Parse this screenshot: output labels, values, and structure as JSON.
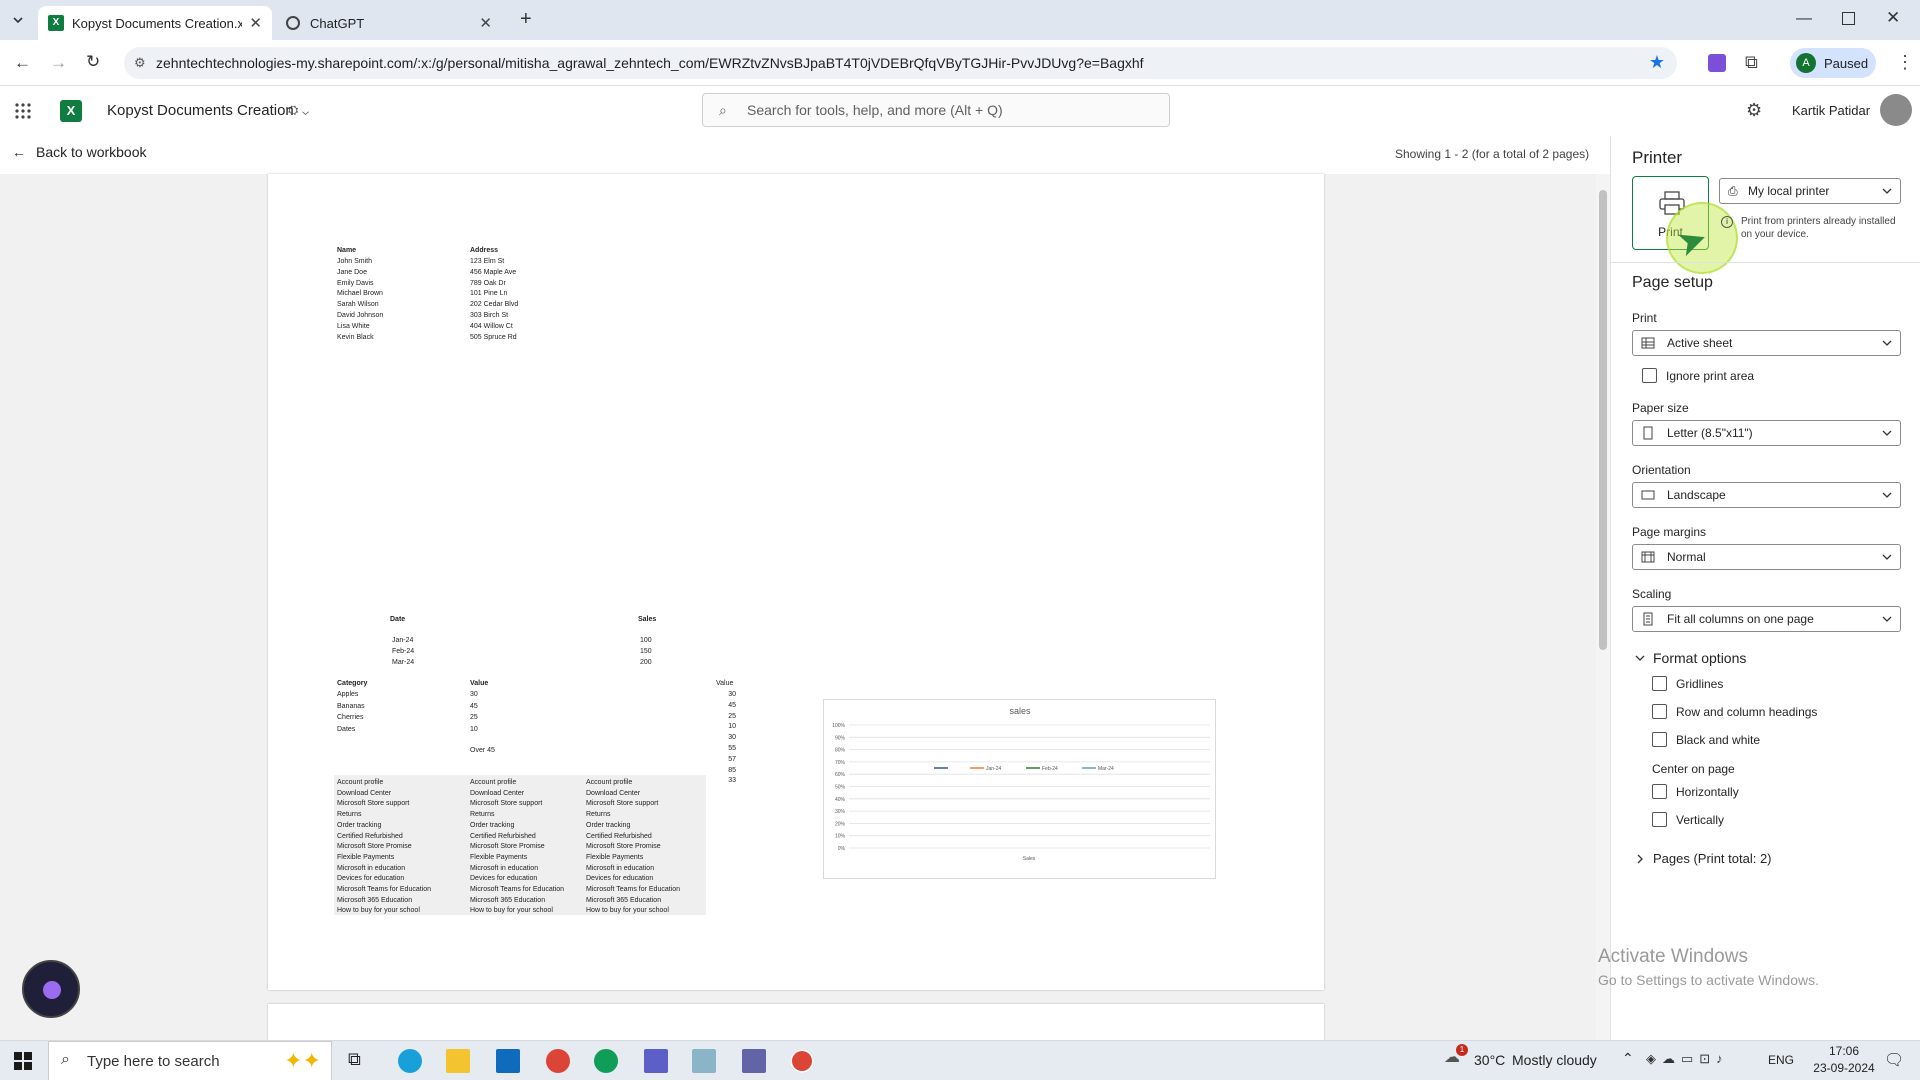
{
  "browser": {
    "tabs": [
      {
        "title": "Kopyst Documents Creation.xls",
        "active": true
      },
      {
        "title": "ChatGPT",
        "active": false
      }
    ],
    "url": "zehntechtechnologies-my.sharepoint.com/:x:/g/personal/mitisha_agrawal_zehntech_com/EWRZtvZNvsBJpaBT4T0jVDEBrQfqVByTGJHir-PvvJDUvg?e=Bagxhf",
    "profile_label": "A",
    "profile_status": "Paused"
  },
  "excel": {
    "app_icon": "X",
    "doc_title": "Kopyst Documents Creation",
    "search_placeholder": "Search for tools, help, and more (Alt + Q)",
    "user_name": "Kartik Patidar"
  },
  "preview": {
    "back_label": "Back to workbook",
    "showing": "Showing 1 - 2 (for a total of 2 pages)",
    "table1": {
      "headers": [
        "Name",
        "Address"
      ],
      "rows": [
        [
          "John Smith",
          "123 Elm St"
        ],
        [
          "Jane Doe",
          "456 Maple Ave"
        ],
        [
          "Emily Davis",
          "789 Oak Dr"
        ],
        [
          "Michael Brown",
          "101 Pine Ln"
        ],
        [
          "Sarah Wilson",
          "202 Cedar Blvd"
        ],
        [
          "David Johnson",
          "303 Birch St"
        ],
        [
          "Lisa White",
          "404 Willow Ct"
        ],
        [
          "Kevin Black",
          "505 Spruce Rd"
        ]
      ]
    },
    "table2": {
      "headers": [
        "Date",
        "Sales"
      ],
      "rows": [
        [
          "Jan-24",
          "100"
        ],
        [
          "Feb-24",
          "150"
        ],
        [
          "Mar-24",
          "200"
        ]
      ]
    },
    "table3": {
      "headers": [
        "Category",
        "Value"
      ],
      "rows": [
        [
          "Apples",
          "30"
        ],
        [
          "Bananas",
          "45"
        ],
        [
          "Cherries",
          "25"
        ],
        [
          "Dates",
          "10"
        ]
      ],
      "note": "Over 45"
    },
    "value_col": {
      "header": "Value",
      "values": [
        "30",
        "45",
        "25",
        "10",
        "30",
        "55",
        "57",
        "85",
        "33"
      ]
    },
    "links_table": {
      "items": [
        "Account profile",
        "Download Center",
        "Microsoft Store support",
        "Returns",
        "Order tracking",
        "Certified Refurbished",
        "Microsoft Store Promise",
        "Flexible Payments",
        "Microsoft in education",
        "Devices for education",
        "Microsoft Teams for Education",
        "Microsoft 365 Education",
        "How to buy for your school"
      ]
    }
  },
  "chart_data": {
    "type": "line",
    "title": "sales",
    "xlabel": "Sales",
    "ylabel": "",
    "y_ticks": [
      "0%",
      "10%",
      "20%",
      "30%",
      "40%",
      "50%",
      "60%",
      "70%",
      "80%",
      "90%",
      "100%"
    ],
    "ylim": [
      0,
      100
    ],
    "legend_position": "center",
    "series": [
      {
        "name": "",
        "color": "#2f5597"
      },
      {
        "name": "Jan-24",
        "color": "#ed7d31"
      },
      {
        "name": "Feb-24",
        "color": "#2e7d32"
      },
      {
        "name": "Mar-24",
        "color": "#5b9bd5"
      }
    ]
  },
  "panel": {
    "printer_title": "Printer",
    "print_button": "Print",
    "printer_select": "My local printer",
    "printer_info": "Print from printers already installed on your device.",
    "page_setup_title": "Page setup",
    "print_label": "Print",
    "print_value": "Active sheet",
    "ignore_print_area": "Ignore print area",
    "paper_size_label": "Paper size",
    "paper_size_value": "Letter (8.5\"x11\")",
    "orientation_label": "Orientation",
    "orientation_value": "Landscape",
    "margins_label": "Page margins",
    "margins_value": "Normal",
    "scaling_label": "Scaling",
    "scaling_value": "Fit all columns on one page",
    "format_options_title": "Format options",
    "gridlines": "Gridlines",
    "row_col_headings": "Row and column headings",
    "black_white": "Black and white",
    "center_title": "Center on page",
    "horizontally": "Horizontally",
    "vertically": "Vertically",
    "pages_title": "Pages (Print total: 2)"
  },
  "watermark": {
    "line1": "Activate Windows",
    "line2": "Go to Settings to activate Windows."
  },
  "taskbar": {
    "search_placeholder": "Type here to search",
    "weather_temp": "30°C",
    "weather_text": "Mostly cloudy",
    "language": "ENG",
    "time": "17:06",
    "date": "23-09-2024",
    "notification_count": "1"
  }
}
